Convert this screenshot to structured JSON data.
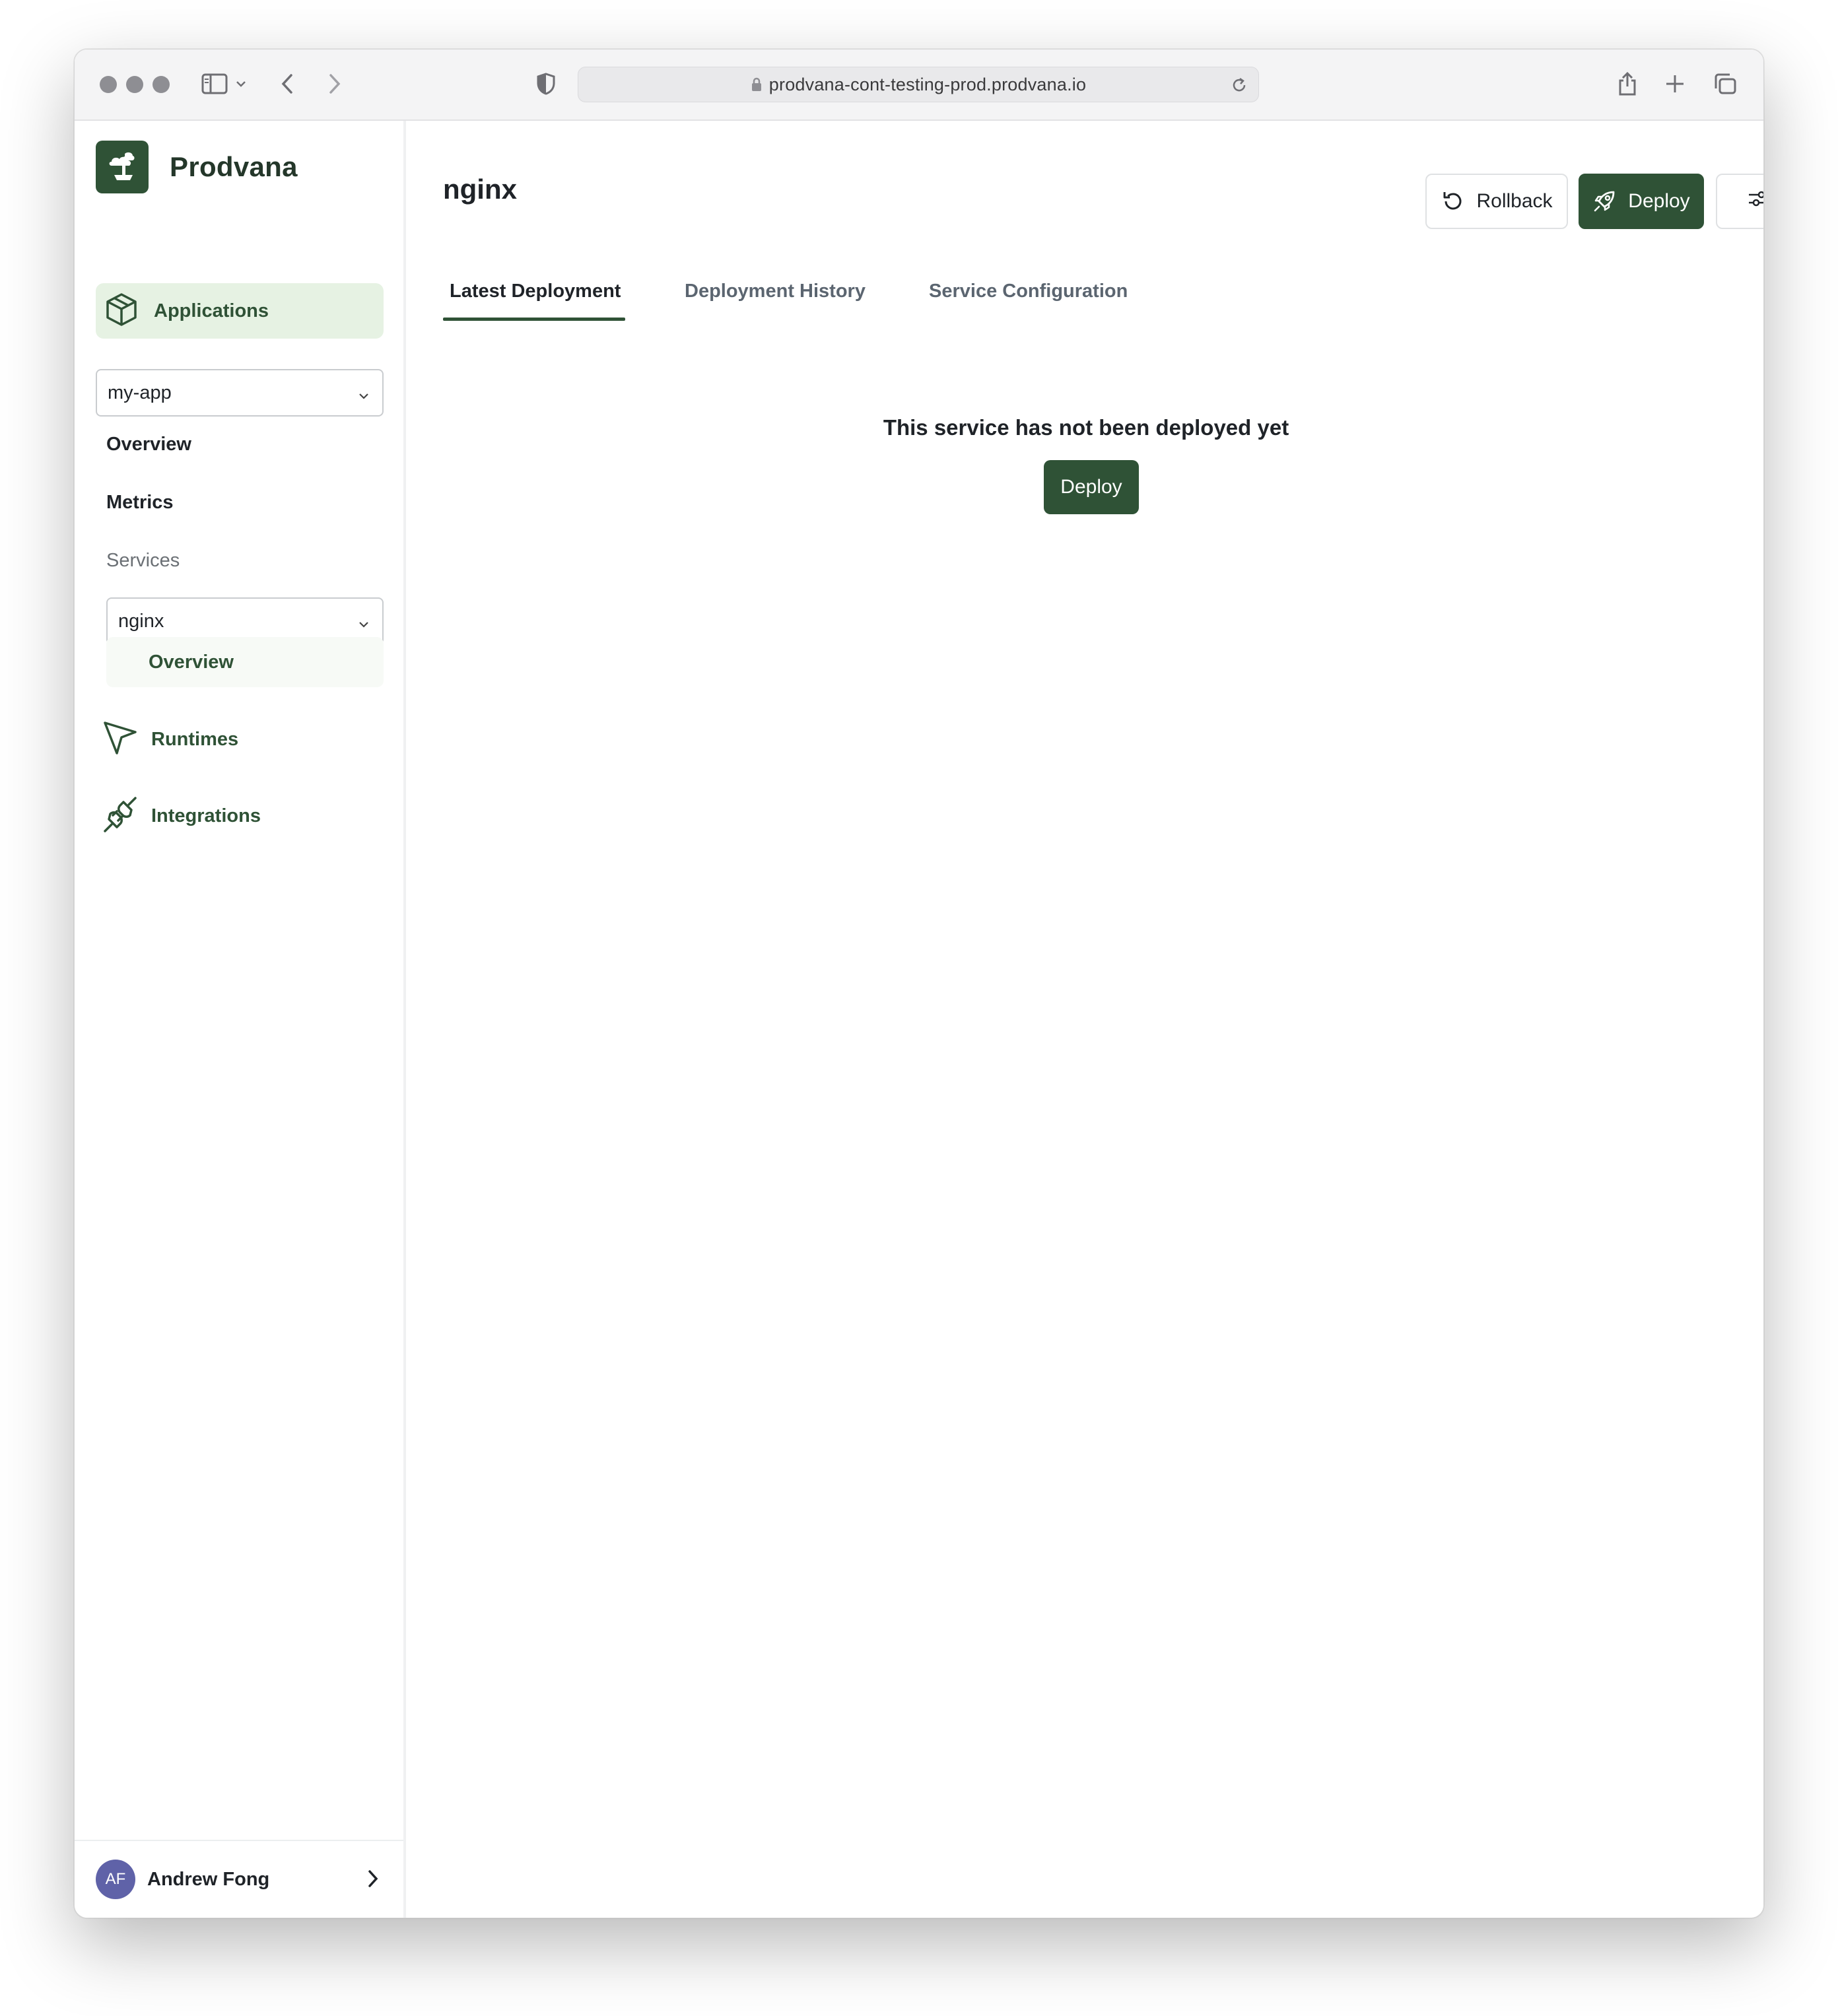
{
  "browser": {
    "url": "prodvana-cont-testing-prod.prodvana.io"
  },
  "sidebar": {
    "brand": "Prodvana",
    "applications_label": "Applications",
    "app_select_value": "my-app",
    "app_links": {
      "overview": "Overview",
      "metrics": "Metrics"
    },
    "services_section": "Services",
    "service_select_value": "nginx",
    "service_links": {
      "overview": "Overview"
    },
    "runtimes_label": "Runtimes",
    "integrations_label": "Integrations",
    "user": {
      "initials": "AF",
      "name": "Andrew Fong"
    }
  },
  "main": {
    "title": "nginx",
    "actions": {
      "rollback": "Rollback",
      "deploy": "Deploy"
    },
    "tabs": {
      "latest": "Latest Deployment",
      "history": "Deployment History",
      "config": "Service Configuration"
    },
    "empty_state": {
      "message": "This service has not been deployed yet",
      "button": "Deploy"
    }
  },
  "theme": {
    "primary": "#2f5236",
    "nav_active_bg": "#e6f2e3",
    "avatar_bg": "#5f62a8"
  }
}
